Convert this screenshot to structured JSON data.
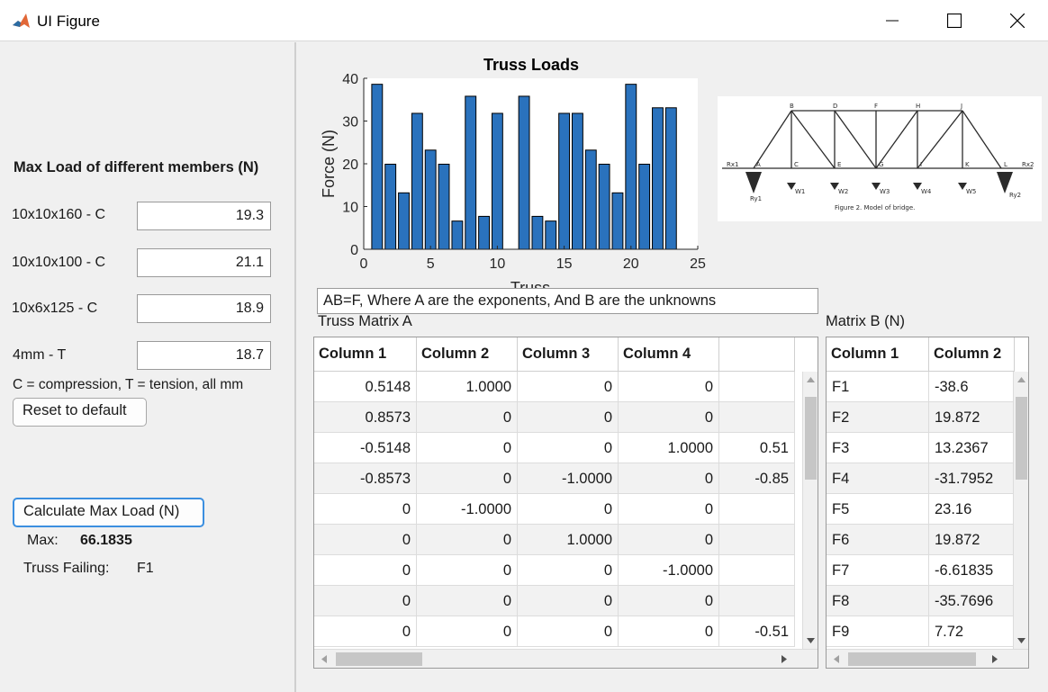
{
  "window": {
    "title": "UI Figure"
  },
  "left": {
    "heading": "Max Load of different members (N)",
    "members": [
      {
        "label": "10x10x160 - C",
        "value": "19.3"
      },
      {
        "label": "10x10x100 - C",
        "value": "21.1"
      },
      {
        "label": "10x6x125 - C",
        "value": "18.9"
      },
      {
        "label": "4mm - T",
        "value": "18.7"
      }
    ],
    "note": "C = compression, T = tension, all mm",
    "reset_label": "Reset to default",
    "calc_label": "Calculate Max Load (N)",
    "max_label": "Max:",
    "max_value": "66.1835",
    "failing_label": "Truss Failing:",
    "failing_value": "F1"
  },
  "equation": "AB=F, Where A are the exponents, And B are the unknowns",
  "tableA": {
    "title": "Truss Matrix A",
    "columns": [
      "Column 1",
      "Column 2",
      "Column 3",
      "Column 4",
      ""
    ],
    "rows": [
      [
        "0.5148",
        "1.0000",
        "0",
        "0",
        ""
      ],
      [
        "0.8573",
        "0",
        "0",
        "0",
        ""
      ],
      [
        "-0.5148",
        "0",
        "0",
        "1.0000",
        "0.51"
      ],
      [
        "-0.8573",
        "0",
        "-1.0000",
        "0",
        "-0.85"
      ],
      [
        "0",
        "-1.0000",
        "0",
        "0",
        ""
      ],
      [
        "0",
        "0",
        "1.0000",
        "0",
        ""
      ],
      [
        "0",
        "0",
        "0",
        "-1.0000",
        ""
      ],
      [
        "0",
        "0",
        "0",
        "0",
        ""
      ],
      [
        "0",
        "0",
        "0",
        "0",
        "-0.51"
      ]
    ]
  },
  "tableB": {
    "title": "Matrix B (N)",
    "columns": [
      "Column 1",
      "Column 2"
    ],
    "rows": [
      [
        "F1",
        "-38.6"
      ],
      [
        "F2",
        "19.872"
      ],
      [
        "F3",
        "13.2367"
      ],
      [
        "F4",
        "-31.7952"
      ],
      [
        "F5",
        "23.16"
      ],
      [
        "F6",
        "19.872"
      ],
      [
        "F7",
        "-6.61835"
      ],
      [
        "F8",
        "-35.7696"
      ],
      [
        "F9",
        "7.72"
      ]
    ]
  },
  "bridge_figure": {
    "caption": "Figure 2.  Model of bridge.",
    "top_nodes": [
      "B",
      "D",
      "F",
      "H",
      "J"
    ],
    "bottom_nodes": [
      "A",
      "C",
      "E",
      "G",
      "I",
      "K",
      "L"
    ],
    "loads": [
      "W1",
      "W2",
      "W3",
      "W4",
      "W5"
    ],
    "reactions": [
      "Rx1",
      "Ry1",
      "Rx2",
      "Ry2"
    ]
  },
  "chart_data": {
    "type": "bar",
    "title": "Truss Loads",
    "xlabel": "Truss",
    "ylabel": "Force (N)",
    "xlim": [
      0,
      25
    ],
    "ylim": [
      0,
      40
    ],
    "xticks": [
      0,
      5,
      10,
      15,
      20,
      25
    ],
    "yticks": [
      0,
      10,
      20,
      30,
      40
    ],
    "color": "#2a72bd",
    "x": [
      1,
      2,
      3,
      4,
      5,
      6,
      7,
      8,
      9,
      10,
      12,
      13,
      14,
      15,
      16,
      17,
      18,
      19,
      20,
      21,
      22,
      23
    ],
    "values": [
      38.6,
      19.9,
      13.2,
      31.8,
      23.2,
      19.9,
      6.6,
      35.8,
      7.7,
      31.8,
      35.8,
      7.7,
      6.6,
      31.8,
      31.8,
      23.2,
      19.9,
      13.2,
      38.6,
      19.9,
      33.1,
      33.1
    ]
  }
}
